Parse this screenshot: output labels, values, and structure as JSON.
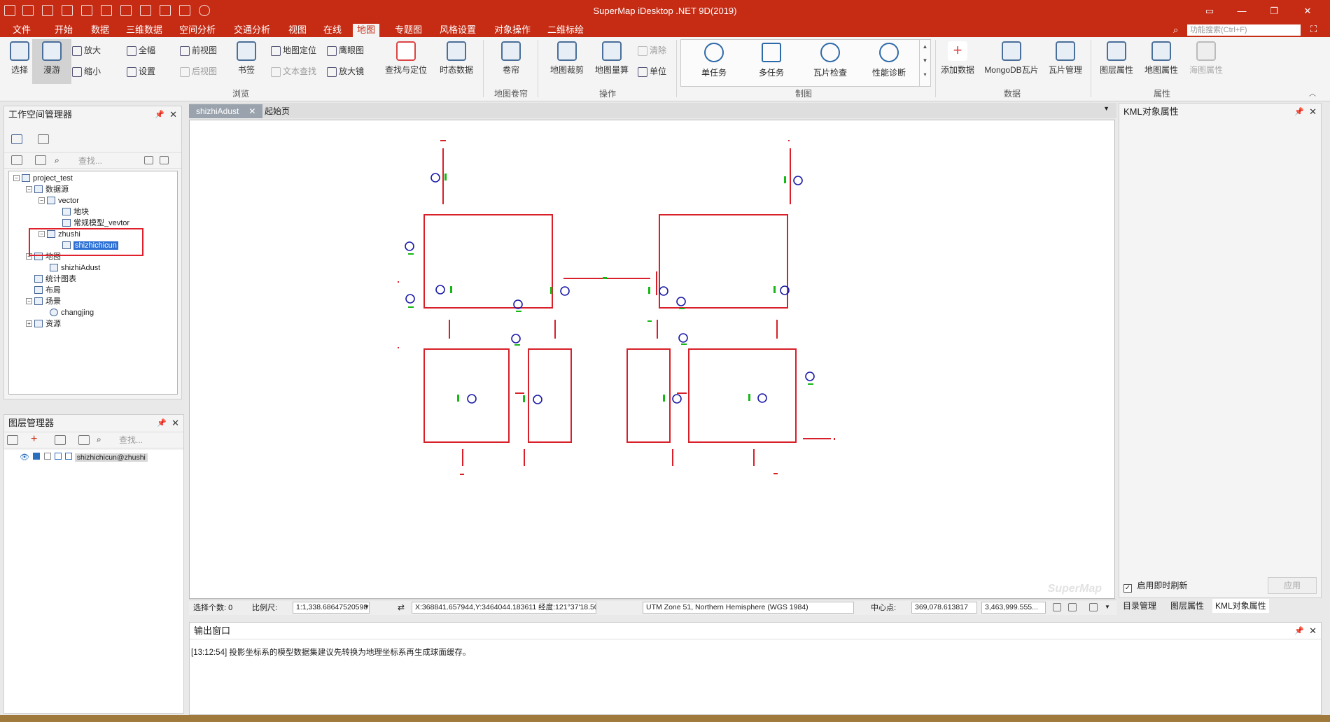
{
  "app": {
    "title": "SuperMap iDesktop .NET 9D(2019)"
  },
  "colors": {
    "accent": "#c62b14",
    "map_line": "#d8202a",
    "map_circle": "#1a1aa8",
    "map_label": "#16b816"
  },
  "menu": {
    "items": [
      "文件",
      "开始",
      "数据",
      "三维数据",
      "空间分析",
      "交通分析",
      "视图",
      "在线",
      "地图",
      "专题图",
      "风格设置",
      "对象操作",
      "二维标绘"
    ],
    "active": "地图",
    "search_placeholder": "功能搜索(Ctrl+F)"
  },
  "ribbon": {
    "browse": {
      "label": "浏览",
      "select": "选择",
      "pan": "漫游",
      "zoom_in": "放大",
      "zoom_out": "缩小",
      "full_extent": "全幅",
      "settings": "设置",
      "prev_view": "前视图",
      "next_view": "后视图",
      "bookmark": "书签",
      "map_locate": "地图定位",
      "eagle_eye": "鹰眼图",
      "text_search": "文本查找",
      "magnifier": "放大镜",
      "find_locate": "查找与定位",
      "temporal": "时态数据"
    },
    "swipe": {
      "label": "地图卷帘",
      "swipe": "卷帘"
    },
    "operate": {
      "label": "操作",
      "clip": "地图裁剪",
      "measure": "地图量算",
      "clear": "清除",
      "unit": "单位"
    },
    "cartography": {
      "label": "制图",
      "single_task": "单任务",
      "multi_task": "多任务",
      "tile_check": "瓦片检查",
      "perf_diag": "性能诊断"
    },
    "data": {
      "label": "数据",
      "add_data": "添加数据",
      "mongodb": "MongoDB瓦片",
      "tile_mgmt": "瓦片管理"
    },
    "property": {
      "label": "属性",
      "layer_prop": "图层属性",
      "map_prop": "地图属性",
      "chart_prop": "海图属性"
    }
  },
  "workspace": {
    "title": "工作空间管理器",
    "search_placeholder": "查找...",
    "tree": {
      "root": "project_test",
      "datasources": "数据源",
      "vector": "vector",
      "parcel": "地块",
      "model": "常规模型_vevtor",
      "zhushi": "zhushi",
      "shizhichicun": "shizhichicun",
      "maps": "地图",
      "shizhiAdust": "shizhiAdust",
      "charts": "统计图表",
      "layouts": "布局",
      "scenes": "场景",
      "changjing": "changjing",
      "resources": "资源"
    }
  },
  "layers": {
    "title": "图层管理器",
    "search_placeholder": "查找...",
    "items": [
      "shizhichicun@zhushi"
    ]
  },
  "tabs": {
    "map_tab": "shizhiAdust",
    "start_tab": "起始页"
  },
  "statusbar": {
    "select_count": "选择个数: 0",
    "scale_label": "比例尺:",
    "scale_value": "1:1,338.68647520598",
    "coords": "X:368841.657944,Y:3464044.183611  经度:121°37'18.50\",纬...",
    "crs": "UTM Zone 51, Northern Hemisphere (WGS 1984)",
    "center_label": "中心点:",
    "center_x": "369,078.613817",
    "center_y": "3,463,999.555..."
  },
  "kml": {
    "title": "KML对象属性",
    "auto_refresh": "启用即时刷新",
    "apply": "应用",
    "tabs": [
      "目录管理",
      "图层属性",
      "KML对象属性"
    ],
    "active_tab": "KML对象属性"
  },
  "output": {
    "title": "输出窗口",
    "message": "[13:12:54] 投影坐标系的模型数据集建议先转换为地理坐标系再生成球面缓存。"
  },
  "watermark": "SuperMap"
}
